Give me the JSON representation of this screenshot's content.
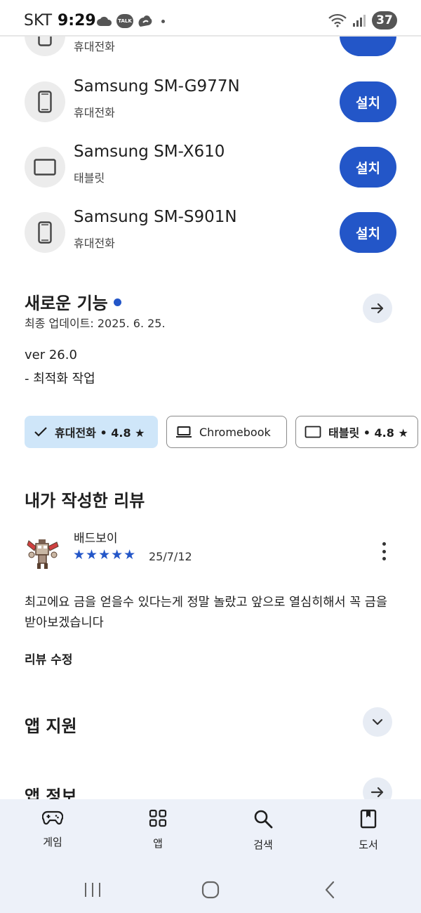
{
  "status_bar": {
    "carrier": "SKT",
    "time": "9:29",
    "talk_badge": "TALK",
    "battery": "37"
  },
  "devices": [
    {
      "name": "",
      "type": "휴대전화",
      "install_label": "",
      "icon": "phone-icon"
    },
    {
      "name": "Samsung SM-G977N",
      "type": "휴대전화",
      "install_label": "설치",
      "icon": "phone-icon"
    },
    {
      "name": "Samsung SM-X610",
      "type": "태블릿",
      "install_label": "설치",
      "icon": "tablet-icon"
    },
    {
      "name": "Samsung SM-S901N",
      "type": "휴대전화",
      "install_label": "설치",
      "icon": "phone-icon"
    }
  ],
  "whats_new": {
    "title": "새로운 기능",
    "updated": "최종 업데이트: 2025. 6. 25.",
    "version": "ver 26.0",
    "notes": "- 최적화 작업"
  },
  "device_chips": [
    {
      "label": "휴대전화 • 4.8 ★",
      "selected": true,
      "icon": "check-icon"
    },
    {
      "label": "Chromebook",
      "selected": false,
      "icon": "laptop-icon"
    },
    {
      "label": "태블릿 • 4.8 ★",
      "selected": false,
      "icon": "tablet-icon"
    }
  ],
  "my_review": {
    "title": "내가 작성한 리뷰",
    "author": "배드보이",
    "rating": 5,
    "stars": "★★★★★",
    "date": "25/7/12",
    "text": "최고에요 금을 얻을수 있다는게 정말 놀랐고 앞으로 열심히해서 꼭 금을 받아보겠습니다",
    "edit_label": "리뷰 수정"
  },
  "app_support": {
    "title": "앱 지원"
  },
  "app_info": {
    "title": "앱 정보"
  },
  "bottom_nav": [
    {
      "label": "게임",
      "icon": "gamepad-icon"
    },
    {
      "label": "앱",
      "icon": "apps-grid-icon"
    },
    {
      "label": "검색",
      "icon": "search-icon"
    },
    {
      "label": "도서",
      "icon": "book-icon"
    }
  ],
  "colors": {
    "accent": "#2356c8",
    "chip_selected": "#cfe6f9",
    "nav_background": "#edf1f9"
  }
}
